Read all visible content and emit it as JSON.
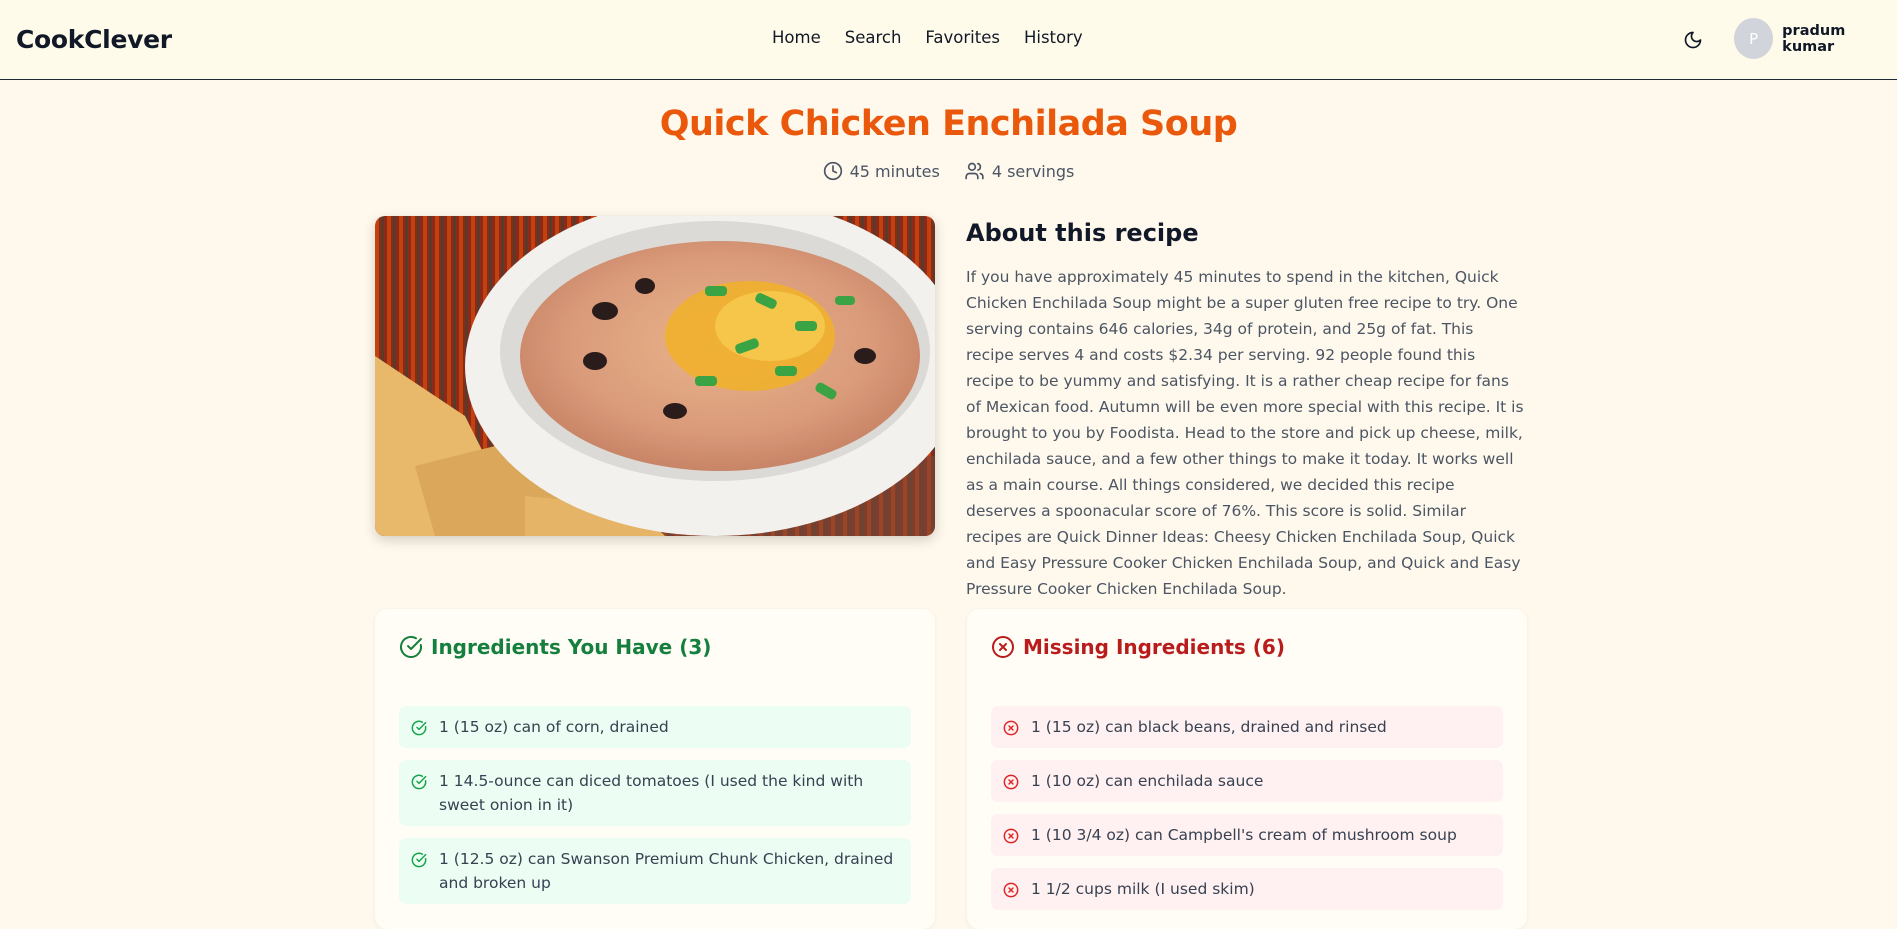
{
  "nav": {
    "brand": "CookClever",
    "links": [
      "Home",
      "Search",
      "Favorites",
      "History"
    ],
    "user_initial": "P",
    "user_name": "pradum kumar"
  },
  "recipe": {
    "title": "Quick Chicken Enchilada Soup",
    "time": "45 minutes",
    "servings": "4 servings",
    "about_heading": "About this recipe",
    "about": "If you have approximately 45 minutes to spend in the kitchen, Quick Chicken Enchilada Soup might be a super gluten free recipe to try. One serving contains 646 calories, 34g of protein, and 25g of fat. This recipe serves 4 and costs $2.34 per serving. 92 people found this recipe to be yummy and satisfying. It is a rather cheap recipe for fans of Mexican food. Autumn will be even more special with this recipe. It is brought to you by Foodista. Head to the store and pick up cheese, milk, enchilada sauce, and a few other things to make it today. It works well as a main course. All things considered, we decided this recipe deserves a spoonacular score of 76%. This score is solid. Similar recipes are Quick Dinner Ideas: Cheesy Chicken Enchilada Soup, Quick and Easy Pressure Cooker Chicken Enchilada Soup, and Quick and Easy Pressure Cooker Chicken Enchilada Soup."
  },
  "have": {
    "heading": "Ingredients You Have (3)",
    "items": [
      "1 (15 oz) can of corn, drained",
      "1 14.5-ounce can diced tomatoes (I used the kind with sweet onion in it)",
      "1 (12.5 oz) can Swanson Premium Chunk Chicken, drained and broken up"
    ]
  },
  "missing": {
    "heading": "Missing Ingredients (6)",
    "items": [
      "1 (15 oz) can black beans, drained and rinsed",
      "1 (10 oz) can enchilada sauce",
      "1 (10 3/4 oz) can Campbell's cream of mushroom soup",
      "1 1/2 cups milk (I used skim)"
    ]
  },
  "colors": {
    "accent": "#ea580c",
    "have": "#15803d",
    "missing": "#b91c1c",
    "background": "#fff9ed"
  }
}
